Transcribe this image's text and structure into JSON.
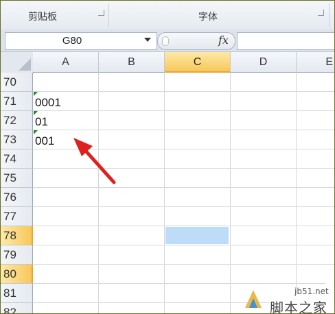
{
  "ribbon": {
    "groups": [
      {
        "label": "剪贴板"
      },
      {
        "label": "字体"
      }
    ]
  },
  "formula_bar": {
    "name_box": "G80",
    "fx_icon": "fx"
  },
  "columns": [
    "A",
    "B",
    "C",
    "D",
    "E"
  ],
  "selected_column": "C",
  "rows": [
    "70",
    "71",
    "72",
    "73",
    "74",
    "75",
    "76",
    "77",
    "78",
    "79",
    "80",
    "81",
    "82"
  ],
  "selected_rows": [
    "78",
    "80"
  ],
  "cells": [
    {
      "ref": "A71",
      "value": "0001",
      "error_indicator": true
    },
    {
      "ref": "A72",
      "value": "01",
      "error_indicator": true
    },
    {
      "ref": "A73",
      "value": "001",
      "error_indicator": true
    }
  ],
  "active_cell_highlight": "C78",
  "annotation": {
    "type": "arrow",
    "color": "#e02020",
    "points_to": "A73"
  },
  "watermark": {
    "url": "jb51.net",
    "name": "脚本之家"
  },
  "colors": {
    "selected_header": "#f7c75a",
    "selected_cell": "#bcdcf8",
    "error_triangle": "#1a8a2a"
  }
}
